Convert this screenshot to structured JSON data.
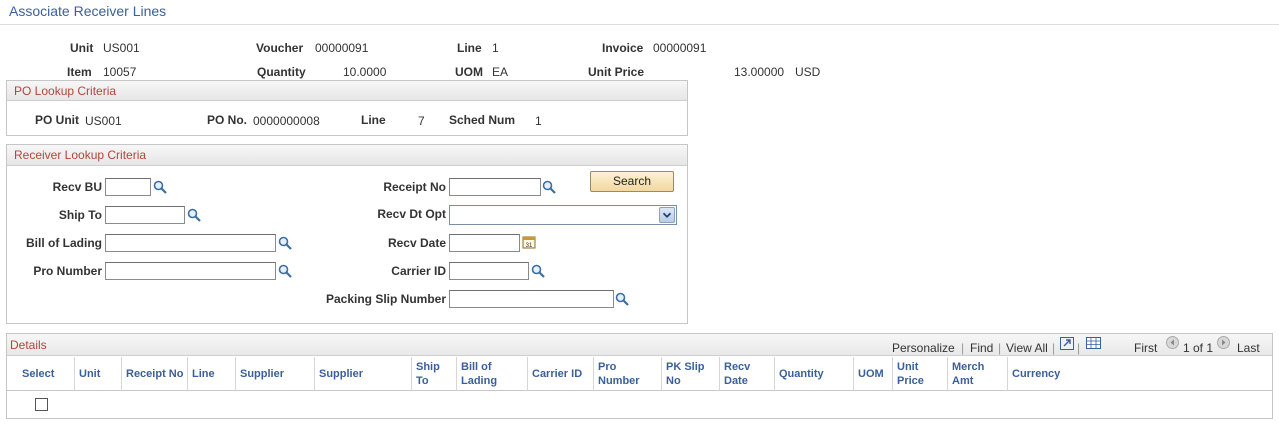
{
  "page": {
    "title": "Associate Receiver Lines"
  },
  "header": {
    "unit_label": "Unit",
    "unit_value": "US001",
    "voucher_label": "Voucher",
    "voucher_value": "00000091",
    "line_label": "Line",
    "line_value": "1",
    "invoice_label": "Invoice",
    "invoice_value": "00000091",
    "item_label": "Item",
    "item_value": "10057",
    "quantity_label": "Quantity",
    "quantity_value": "10.0000",
    "uom_label": "UOM",
    "uom_value": "EA",
    "unit_price_label": "Unit Price",
    "unit_price_value": "13.00000",
    "currency_value": "USD"
  },
  "po_lookup": {
    "title": "PO Lookup Criteria",
    "po_unit_label": "PO Unit",
    "po_unit_value": "US001",
    "po_no_label": "PO No.",
    "po_no_value": "0000000008",
    "line_label": "Line",
    "line_value": "7",
    "sched_label": "Sched Num",
    "sched_value": "1"
  },
  "receiver_lookup": {
    "title": "Receiver Lookup Criteria",
    "recv_bu_label": "Recv BU",
    "recv_bu_value": "",
    "ship_to_label": "Ship To",
    "ship_to_value": "",
    "bill_of_lading_label": "Bill of Lading",
    "bill_of_lading_value": "",
    "pro_number_label": "Pro Number",
    "pro_number_value": "",
    "receipt_no_label": "Receipt No",
    "receipt_no_value": "",
    "recv_dt_opt_label": "Recv Dt Opt",
    "recv_dt_opt_value": "",
    "recv_date_label": "Recv Date",
    "recv_date_value": "",
    "carrier_id_label": "Carrier ID",
    "carrier_id_value": "",
    "packing_slip_label": "Packing Slip Number",
    "packing_slip_value": "",
    "search_label": "Search"
  },
  "details": {
    "title": "Details",
    "personalize": "Personalize",
    "find": "Find",
    "view_all": "View All",
    "first": "First",
    "page_indicator": "1 of 1",
    "last": "Last",
    "sep": "|",
    "columns": {
      "select": "Select",
      "unit": "Unit",
      "receipt_no": "Receipt No",
      "line": "Line",
      "supplier1": "Supplier",
      "supplier2": "Supplier",
      "ship_to": "Ship To",
      "bill_of_lading": "Bill of Lading",
      "carrier_id": "Carrier ID",
      "pro_number": "Pro Number",
      "pk_slip_no": "PK Slip No",
      "recv_date": "Recv Date",
      "quantity": "Quantity",
      "uom": "UOM",
      "unit_price": "Unit Price",
      "merch_amt": "Merch Amt",
      "currency": "Currency"
    }
  },
  "colors": {
    "accent": "#3b5f9a",
    "group_title": "#b0463c"
  }
}
